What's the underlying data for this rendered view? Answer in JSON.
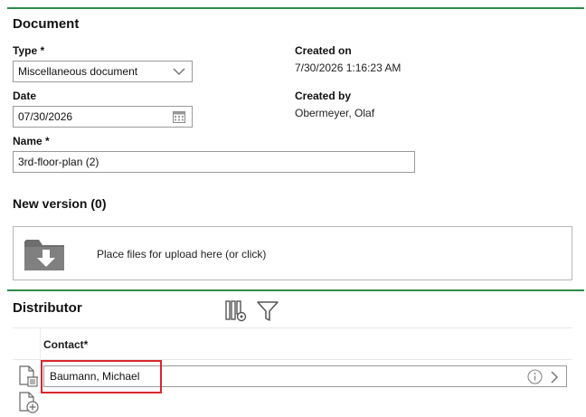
{
  "document": {
    "heading": "Document",
    "type_label": "Type *",
    "type_value": "Miscellaneous document",
    "date_label": "Date",
    "date_value": "07/30/2026",
    "name_label": "Name *",
    "name_value": "3rd-floor-plan (2)",
    "created_on_label": "Created on",
    "created_on_value": "7/30/2026 1:16:23 AM",
    "created_by_label": "Created by",
    "created_by_value": "Obermeyer, Olaf"
  },
  "new_version": {
    "heading": "New version (0)",
    "dropzone_text": "Place files for upload here (or click)"
  },
  "distributor": {
    "heading": "Distributor",
    "column_contact": "Contact*",
    "contact_value": "Baumann, Michael"
  },
  "colors": {
    "accent_rule": "#2e8b4a",
    "highlight": "#d9262c"
  }
}
